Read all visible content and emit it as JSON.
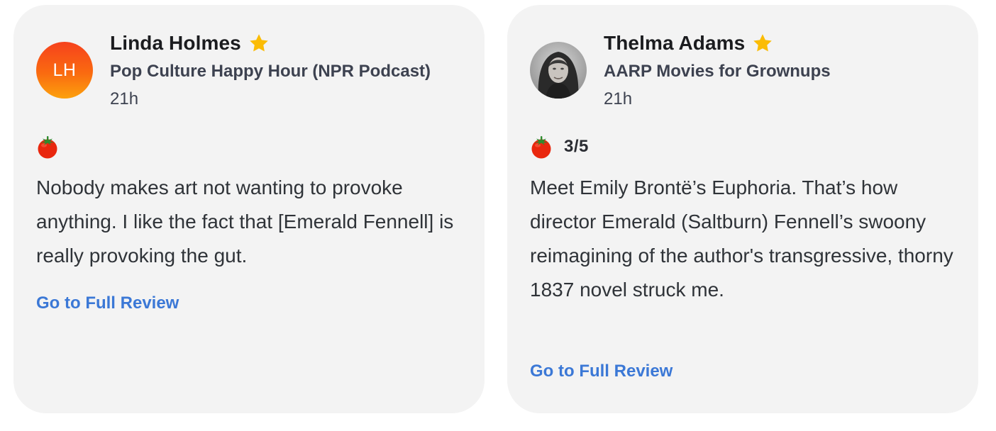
{
  "reviews": [
    {
      "critic_name": "Linda Holmes",
      "avatar_initials": "LH",
      "top_critic_icon": "star-icon",
      "publication": "Pop Culture Happy Hour (NPR Podcast)",
      "timestamp": "21h",
      "score_icon": "tomato-icon",
      "score": "",
      "quote": "Nobody makes art not wanting to provoke anything. I like the fact that [Emerald Fennell] is really provoking the gut.",
      "link_label": "Go to Full Review"
    },
    {
      "critic_name": "Thelma Adams",
      "avatar_initials": "",
      "top_critic_icon": "star-icon",
      "publication": "AARP Movies for Grownups",
      "timestamp": "21h",
      "score_icon": "tomato-icon",
      "score": "3/5",
      "quote": "Meet Emily Brontë’s Euphoria. That’s how director Emerald (Saltburn) Fennell’s swoony reimagining of the author's transgressive, thorny 1837 novel struck me.",
      "link_label": "Go to Full Review"
    }
  ],
  "colors": {
    "card_background": "#f3f3f3",
    "link": "#3b78d6",
    "star": "#fbbc05",
    "tomato": "#e9270e",
    "avatar_gradient_top": "#f6421d",
    "avatar_gradient_bottom": "#fca10d"
  }
}
